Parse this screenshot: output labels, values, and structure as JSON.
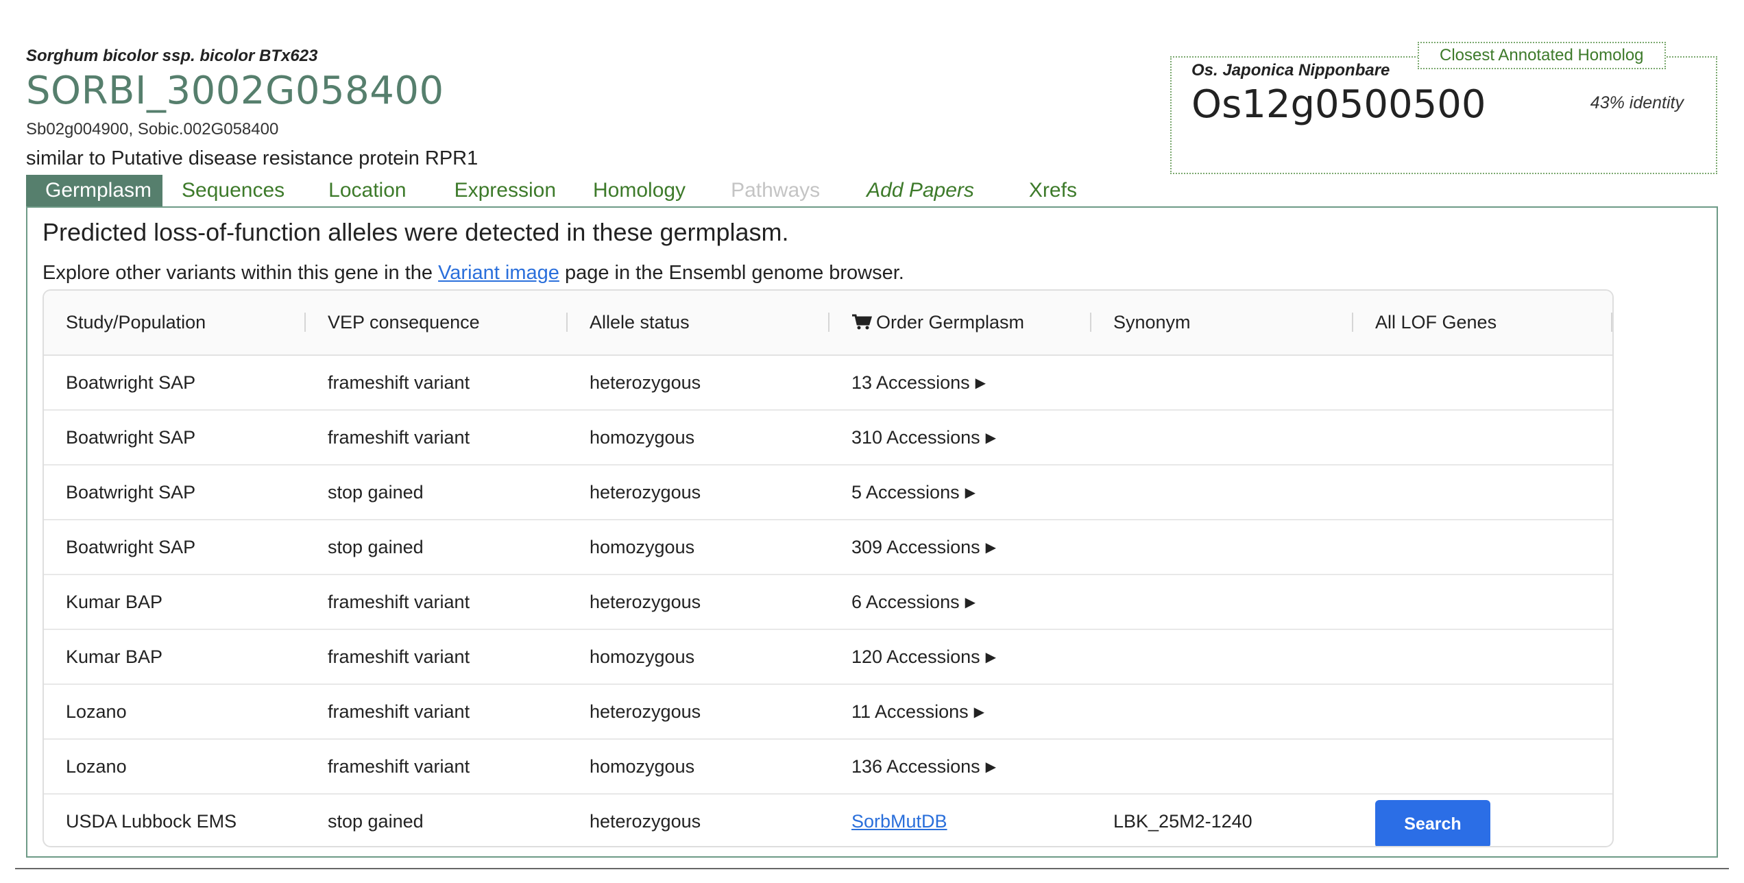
{
  "header": {
    "species": "Sorghum bicolor ssp. bicolor BTx623",
    "gene_id": "SORBI_3002G058400",
    "synonyms": "Sb02g004900, Sobic.002G058400",
    "description": "similar to Putative disease resistance protein RPR1"
  },
  "homolog": {
    "label": "Closest Annotated Homolog",
    "species": "Os. Japonica Nipponbare",
    "gene_id": "Os12g0500500",
    "identity": "43% identity"
  },
  "tabs": [
    {
      "label": "Germplasm",
      "state": "active"
    },
    {
      "label": "Sequences",
      "state": "normal"
    },
    {
      "label": "Location",
      "state": "normal"
    },
    {
      "label": "Expression",
      "state": "normal"
    },
    {
      "label": "Homology",
      "state": "normal"
    },
    {
      "label": "Pathways",
      "state": "disabled"
    },
    {
      "label": "Add Papers",
      "state": "italic"
    },
    {
      "label": "Xrefs",
      "state": "normal"
    }
  ],
  "panel": {
    "heading": "Predicted loss-of-function alleles were detected in these germplasm.",
    "explore_prefix": "Explore other variants within this gene in the ",
    "explore_link": "Variant image",
    "explore_suffix": " page in the Ensembl genome browser."
  },
  "table": {
    "columns": [
      "Study/Population",
      "VEP consequence",
      "Allele status",
      "Order Germplasm",
      "Synonym",
      "All LOF Genes"
    ],
    "rows": [
      {
        "study": "Boatwright SAP",
        "vep": "frameshift variant",
        "allele": "heterozygous",
        "order": "13 Accessions",
        "synonym": "",
        "lof": ""
      },
      {
        "study": "Boatwright SAP",
        "vep": "frameshift variant",
        "allele": "homozygous",
        "order": "310 Accessions",
        "synonym": "",
        "lof": ""
      },
      {
        "study": "Boatwright SAP",
        "vep": "stop gained",
        "allele": "heterozygous",
        "order": "5 Accessions",
        "synonym": "",
        "lof": ""
      },
      {
        "study": "Boatwright SAP",
        "vep": "stop gained",
        "allele": "homozygous",
        "order": "309 Accessions",
        "synonym": "",
        "lof": ""
      },
      {
        "study": "Kumar BAP",
        "vep": "frameshift variant",
        "allele": "heterozygous",
        "order": "6 Accessions",
        "synonym": "",
        "lof": ""
      },
      {
        "study": "Kumar BAP",
        "vep": "frameshift variant",
        "allele": "homozygous",
        "order": "120 Accessions",
        "synonym": "",
        "lof": ""
      },
      {
        "study": "Lozano",
        "vep": "frameshift variant",
        "allele": "heterozygous",
        "order": "11 Accessions",
        "synonym": "",
        "lof": ""
      },
      {
        "study": "Lozano",
        "vep": "frameshift variant",
        "allele": "homozygous",
        "order": "136 Accessions",
        "synonym": "",
        "lof": ""
      }
    ],
    "last_row": {
      "study": "USDA Lubbock EMS",
      "vep": "stop gained",
      "allele": "heterozygous",
      "order_link": "SorbMutDB",
      "synonym": "LBK_25M2-1240",
      "lof_button": "Search"
    }
  },
  "icons": {
    "cart": "cart-icon",
    "expand": "triangle-right-icon"
  },
  "colors": {
    "brand_green": "#567f6d",
    "tab_green": "#3d7a2a",
    "link_blue": "#2a6fdb",
    "button_blue": "#2b6ee6"
  }
}
